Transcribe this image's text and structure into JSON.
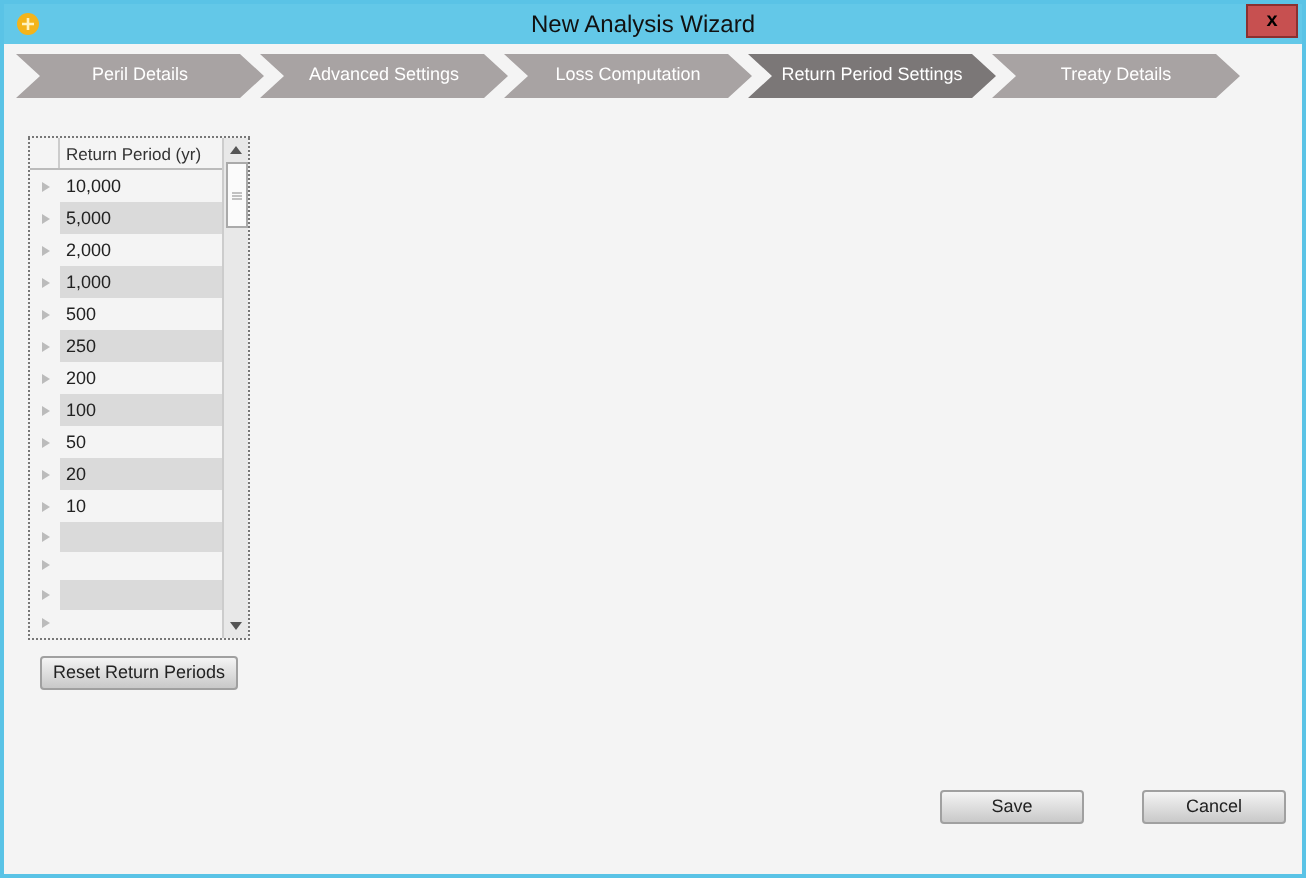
{
  "window": {
    "title": "New Analysis Wizard",
    "close": "x"
  },
  "steps": [
    {
      "label": "Peril Details",
      "selected": false
    },
    {
      "label": "Advanced Settings",
      "selected": false
    },
    {
      "label": "Loss Computation",
      "selected": false
    },
    {
      "label": "Return Period Settings",
      "selected": true
    },
    {
      "label": "Treaty Details",
      "selected": false
    }
  ],
  "table": {
    "columns": [
      "Return Period (yr)"
    ],
    "rows": [
      "10,000",
      "5,000",
      "2,000",
      "1,000",
      "500",
      "250",
      "200",
      "100",
      "50",
      "20",
      "10"
    ]
  },
  "reset_button": "Reset Return Periods",
  "buttons": [
    "Save",
    "Cancel"
  ]
}
